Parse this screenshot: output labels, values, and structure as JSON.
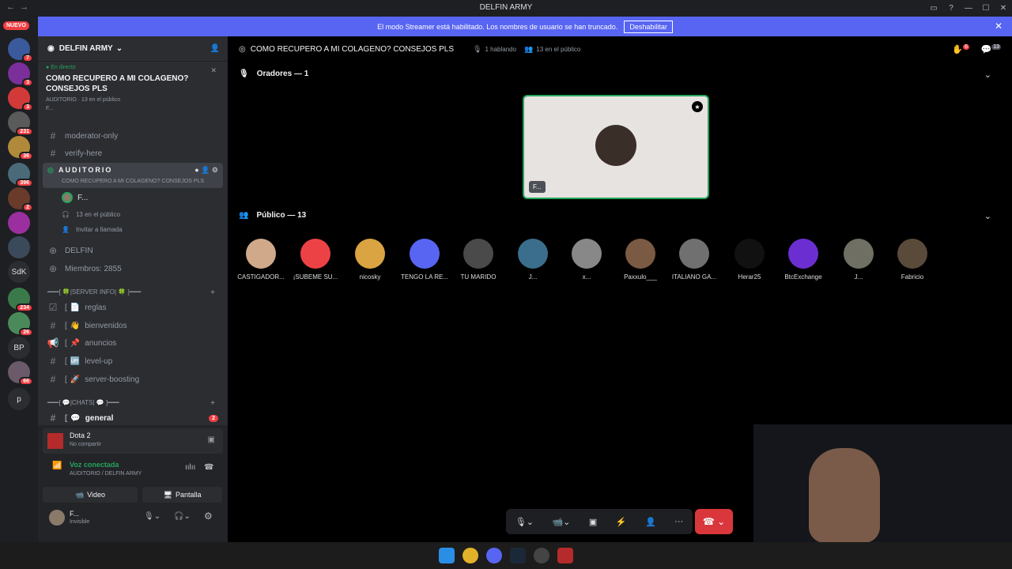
{
  "window": {
    "title": "DELFIN ARMY"
  },
  "banner": {
    "text": "El modo Streamer está habilitado. Los nombres de usuario se han truncado.",
    "button": "Deshabilitar"
  },
  "rail": {
    "new_badge": "NUEVO",
    "servers": [
      {
        "badge": "7"
      },
      {
        "badge": "3"
      },
      {
        "badge": "3"
      },
      {
        "badge": "231"
      },
      {
        "badge": "36"
      },
      {
        "badge": "396"
      },
      {
        "badge": "2"
      },
      {
        "badge": ""
      },
      {
        "badge": ""
      },
      {
        "label": "SdK"
      },
      {
        "badge": "234"
      },
      {
        "badge": "26"
      },
      {
        "label": "BP"
      },
      {
        "badge": "66"
      },
      {
        "label": "p"
      }
    ]
  },
  "sidebar": {
    "server_name": "DELFIN ARMY",
    "live": {
      "tag": "En directo",
      "title": "COMO RECUPERO A MI COLAGENO? CONSEJOS PLS",
      "meta": "AUDITORIO · 13 en el público",
      "user": "F..."
    },
    "channels": [
      {
        "label": "moderator-only"
      },
      {
        "label": "verify-here"
      }
    ],
    "stage": {
      "label": "AUDITORIO",
      "sub": "COMO RECUPERO A MI COLAGENO? CONSEJOS PLS",
      "speaker": "F...",
      "audience": "13 en el público",
      "invite": "Invitar a llamada"
    },
    "delfin": "DELFIN",
    "members": "Miembros: 2855",
    "cat1": "━━━[ 🍀|SERVER INFO| 🍀 ]━━━",
    "info_channels": [
      {
        "label": "reglas"
      },
      {
        "label": "bienvenidos"
      },
      {
        "label": "anuncios"
      },
      {
        "label": "level-up"
      },
      {
        "label": "server-boosting"
      }
    ],
    "cat2": "━━━[ 💬|CHATS| 💬 ]━━━",
    "general": {
      "label": "general",
      "badge": "2"
    }
  },
  "userpanel": {
    "activity": {
      "title": "Dota 2",
      "sub": "No compartir"
    },
    "voice": {
      "status": "Voz conectada",
      "where": "AUDITORIO / DELFIN ARMY"
    },
    "video_btn": "Video",
    "screen_btn": "Pantalla",
    "user": {
      "name": "F...",
      "status": "Invisible"
    }
  },
  "main": {
    "title": "COMO RECUPERO A MI COLAGENO? CONSEJOS PLS",
    "speaking": "1 hablando",
    "audience_count": "13 en el público",
    "speakers_header": "Oradores — 1",
    "speaker_name": "F...",
    "audience_header": "Público — 13",
    "top_badges": [
      "6",
      "13"
    ],
    "audience": [
      {
        "name": "CASTIGADOR...",
        "color": "#cfa98a"
      },
      {
        "name": "¡SUBEME SU...",
        "color": "#ed4245"
      },
      {
        "name": "nicosky",
        "color": "#d9a441"
      },
      {
        "name": "TENGO LA RE...",
        "color": "#5865f2"
      },
      {
        "name": "TU MARIDO",
        "color": "#4a4a4a"
      },
      {
        "name": "J...",
        "color": "#3b6e8c"
      },
      {
        "name": "x...",
        "color": "#888888"
      },
      {
        "name": "Paxxulo___",
        "color": "#7b5a44"
      },
      {
        "name": "ITALIANO GA...",
        "color": "#707070"
      },
      {
        "name": "Herar25",
        "color": "#111111"
      },
      {
        "name": "BtcExchange",
        "color": "#6b2fd1"
      },
      {
        "name": "J...",
        "color": "#6f6f63"
      },
      {
        "name": "Fabricio",
        "color": "#5a4a3a"
      }
    ]
  }
}
